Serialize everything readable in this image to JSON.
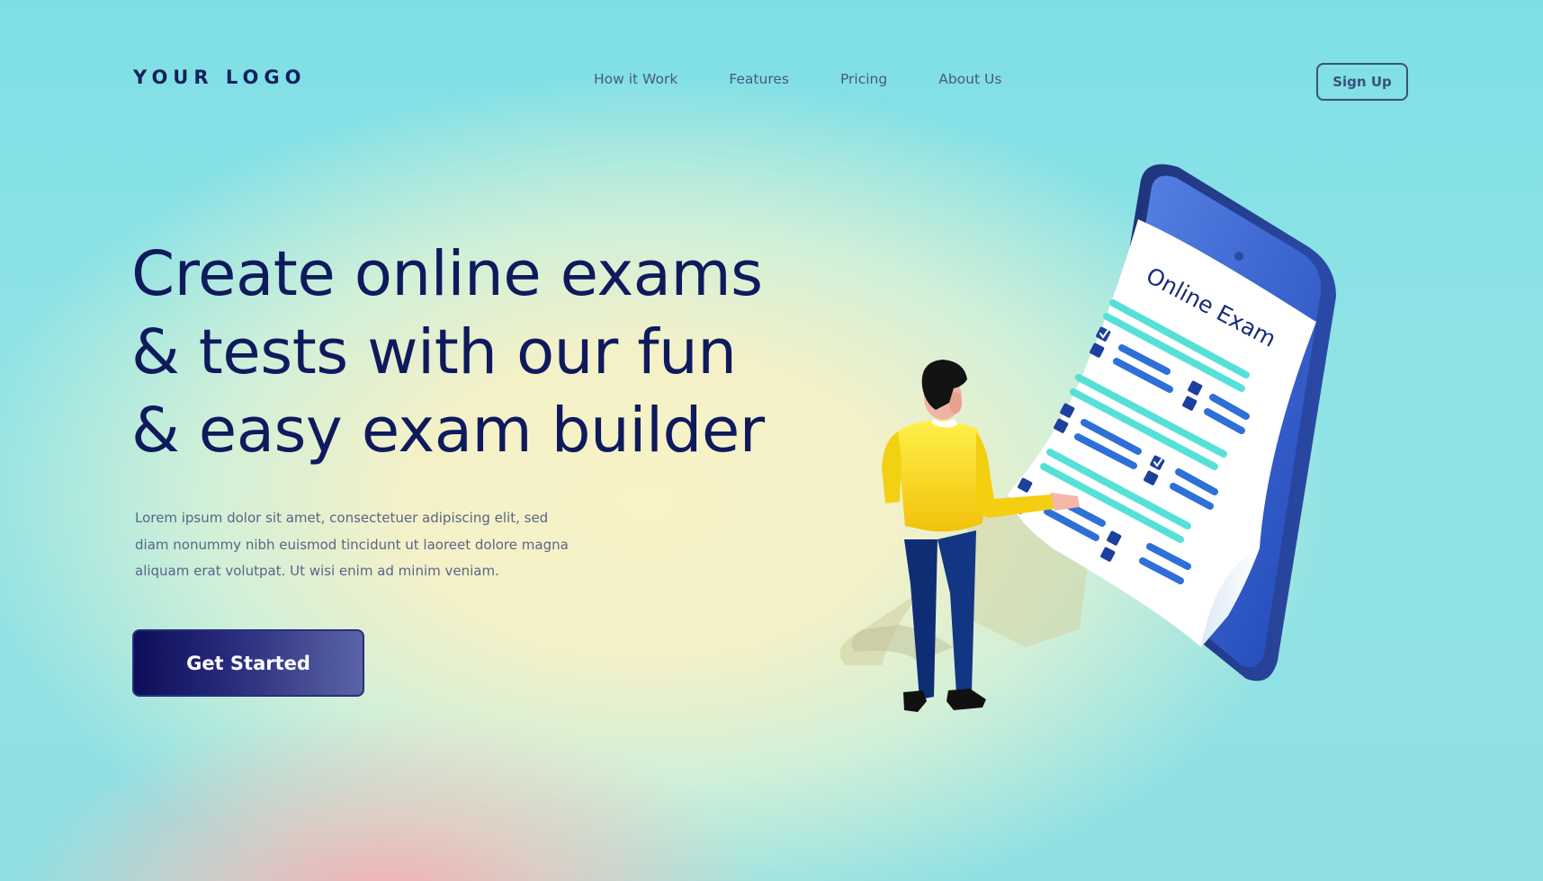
{
  "header": {
    "logo": "YOUR LOGO",
    "nav": [
      "How it Work",
      "Features",
      "Pricing",
      "About Us"
    ],
    "signup_label": "Sign Up"
  },
  "hero": {
    "headline_lines": [
      "Create online exams",
      "& tests with our fun",
      "& easy exam builder"
    ],
    "body_lines": [
      "Lorem ipsum dolor sit amet, consectetuer adipiscing elit, sed",
      "diam nonummy nibh euismod tincidunt ut laoreet dolore magna",
      "aliquam erat volutpat. Ut wisi enim ad minim veniam."
    ],
    "cta_label": "Get Started"
  },
  "illustration": {
    "paper_title": "Online Exam"
  },
  "colors": {
    "brand_navy": "#0f1a5d",
    "phone_blue": "#2f56c9",
    "shirt_yellow": "#f5d414",
    "line_teal": "#4fe0d8",
    "line_blue": "#2f6fd8"
  }
}
